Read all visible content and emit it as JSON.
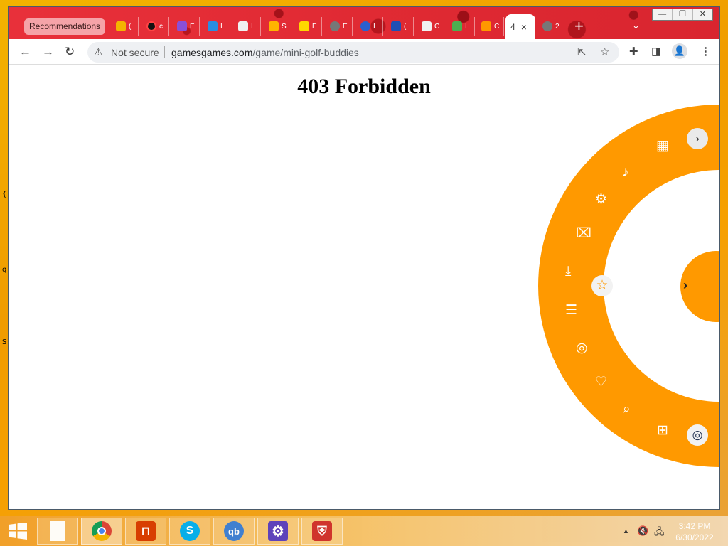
{
  "desktop": {
    "fragments": [
      "{",
      "q",
      "S"
    ]
  },
  "browser": {
    "recommendations_tab": "Recommendations",
    "mini_tabs": [
      {
        "letter": "(",
        "color": "#f4b400"
      },
      {
        "letter": "c",
        "color": "#111111"
      },
      {
        "letter": "E",
        "color": "#8a4fd6"
      },
      {
        "letter": "I",
        "color": "#2a8de0"
      },
      {
        "letter": "I",
        "color": "#f0f0f0"
      },
      {
        "letter": "S",
        "color": "#ffb300"
      },
      {
        "letter": "E",
        "color": "#ffd600"
      },
      {
        "letter": "E",
        "color": "#777777"
      },
      {
        "letter": "I",
        "color": "#2b5fd0"
      },
      {
        "letter": "(",
        "color": "#1f4fb5"
      },
      {
        "letter": "C",
        "color": "#f0f0f0"
      },
      {
        "letter": "I",
        "color": "#4caf50"
      },
      {
        "letter": "C",
        "color": "#ff9800"
      }
    ],
    "active_tab": {
      "title": "4",
      "close": "×"
    },
    "extra_tab": {
      "letter": "2"
    },
    "new_tab": "+",
    "tab_dropdown": "⌄",
    "window_controls": {
      "minimize": "—",
      "restore": "❐",
      "close": "✕"
    },
    "nav": {
      "back": "←",
      "forward": "→",
      "reload": "↻"
    },
    "omnibox": {
      "warning": "⚠",
      "security": "Not secure",
      "domain": "gamesgames.com",
      "path": "/game/mini-golf-buddies",
      "share": "⇱",
      "bookmark": "☆"
    },
    "toolbar_icons": {
      "extensions": "✚",
      "sidepanel": "◨",
      "profile": "👤",
      "menu": "⋮"
    }
  },
  "page": {
    "heading": "403 Forbidden",
    "radial_menu": {
      "top_button": "›",
      "center_arrow": "›",
      "star": "☆",
      "items": [
        {
          "name": "apps-grid-icon",
          "glyph": "▦"
        },
        {
          "name": "music-note-icon",
          "glyph": "♪"
        },
        {
          "name": "settings-gear-icon",
          "glyph": "⚙"
        },
        {
          "name": "bookmark-icon",
          "glyph": "⌧"
        },
        {
          "name": "download-icon",
          "glyph": "⤓"
        },
        {
          "name": "layers-icon",
          "glyph": "☰"
        },
        {
          "name": "hide-eye-icon",
          "glyph": "◎"
        },
        {
          "name": "shield-icon",
          "glyph": "♡"
        },
        {
          "name": "search-icon",
          "glyph": "⌕"
        },
        {
          "name": "folder-add-icon",
          "glyph": "⊞"
        }
      ],
      "bottom_button": "◎"
    }
  },
  "taskbar": {
    "apps": [
      {
        "name": "file-explorer",
        "glyph": "▯",
        "color": "#ffffff"
      },
      {
        "name": "chrome",
        "glyph": "◉",
        "color": "#1a73e8"
      },
      {
        "name": "office",
        "glyph": "▮",
        "color": "#d83b01"
      },
      {
        "name": "skype",
        "glyph": "S",
        "color": "#00aff0"
      },
      {
        "name": "qbittorrent",
        "glyph": "qb",
        "color": "#3c7fd6"
      },
      {
        "name": "settings",
        "glyph": "⚙",
        "color": "#5a3fc0"
      },
      {
        "name": "shield",
        "glyph": "⛨",
        "color": "#d0312d"
      }
    ],
    "tray": {
      "chevron": "▲",
      "volume": "🔇",
      "network": "🖧"
    },
    "clock": {
      "time": "3:42 PM",
      "date": "6/30/2022"
    }
  }
}
